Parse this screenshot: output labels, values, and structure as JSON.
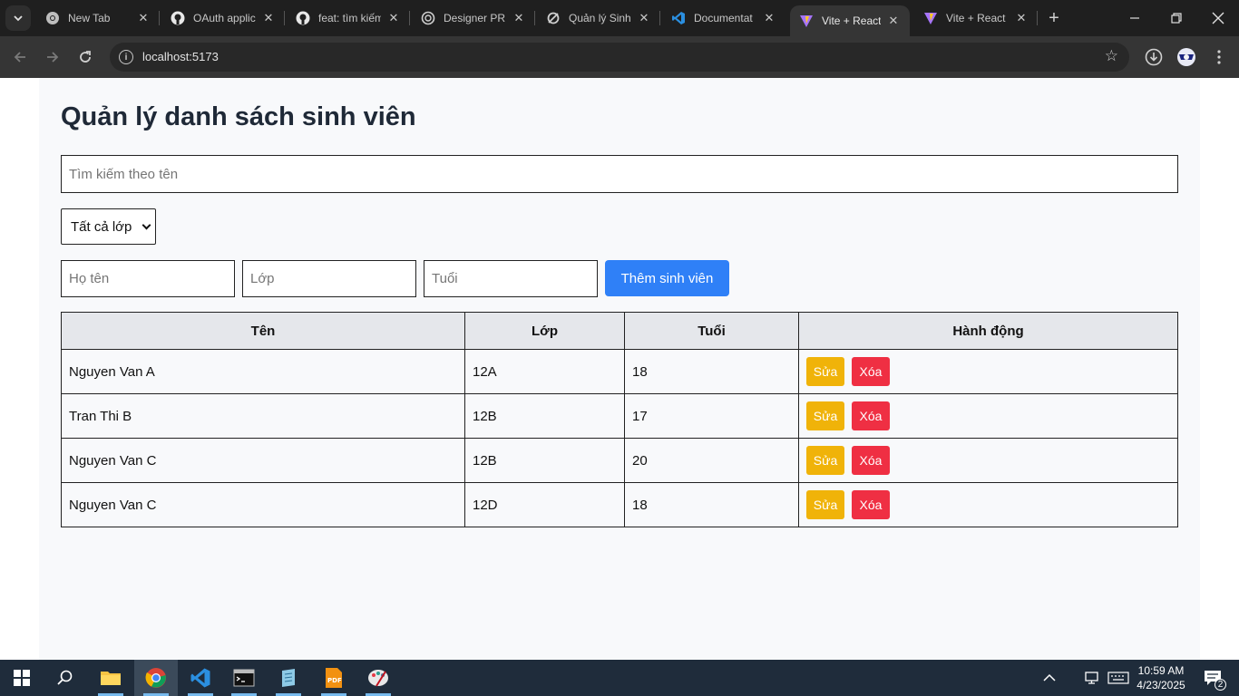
{
  "browser": {
    "tabs": [
      {
        "title": "New Tab",
        "icon": "chrome-icon"
      },
      {
        "title": "OAuth applic",
        "icon": "github-icon"
      },
      {
        "title": "feat: tìm kiếm",
        "icon": "github-icon"
      },
      {
        "title": "Designer PR",
        "icon": "openai-icon"
      },
      {
        "title": "Quản lý Sinh",
        "icon": "loop-icon"
      },
      {
        "title": "Documentat",
        "icon": "vscode-icon"
      },
      {
        "title": "Vite + React",
        "icon": "vite-icon"
      },
      {
        "title": "Vite + React",
        "icon": "vite-icon"
      }
    ],
    "active_tab_index": 6,
    "url": "localhost:5173"
  },
  "app": {
    "title": "Quản lý danh sách sinh viên",
    "search_placeholder": "Tìm kiếm theo tên",
    "class_filter_selected": "Tất cả lớp",
    "form": {
      "name_placeholder": "Họ tên",
      "class_placeholder": "Lớp",
      "age_placeholder": "Tuổi",
      "add_label": "Thêm sinh viên"
    },
    "table": {
      "headers": [
        "Tên",
        "Lớp",
        "Tuổi",
        "Hành động"
      ],
      "rows": [
        {
          "name": "Nguyen Van A",
          "class": "12A",
          "age": "18",
          "edit": "Sửa",
          "delete": "Xóa"
        },
        {
          "name": "Tran Thi B",
          "class": "12B",
          "age": "17",
          "edit": "Sửa",
          "delete": "Xóa"
        },
        {
          "name": "Nguyen Van C",
          "class": "12B",
          "age": "20",
          "edit": "Sửa",
          "delete": "Xóa"
        },
        {
          "name": "Nguyen Van C",
          "class": "12D",
          "age": "18",
          "edit": "Sửa",
          "delete": "Xóa"
        }
      ]
    },
    "colors": {
      "add_button": "#2f80f7",
      "edit_button": "#f0b309",
      "delete_button": "#ef2f43"
    }
  },
  "taskbar": {
    "time": "10:59 AM",
    "date": "4/23/2025",
    "notification_count": "2"
  }
}
